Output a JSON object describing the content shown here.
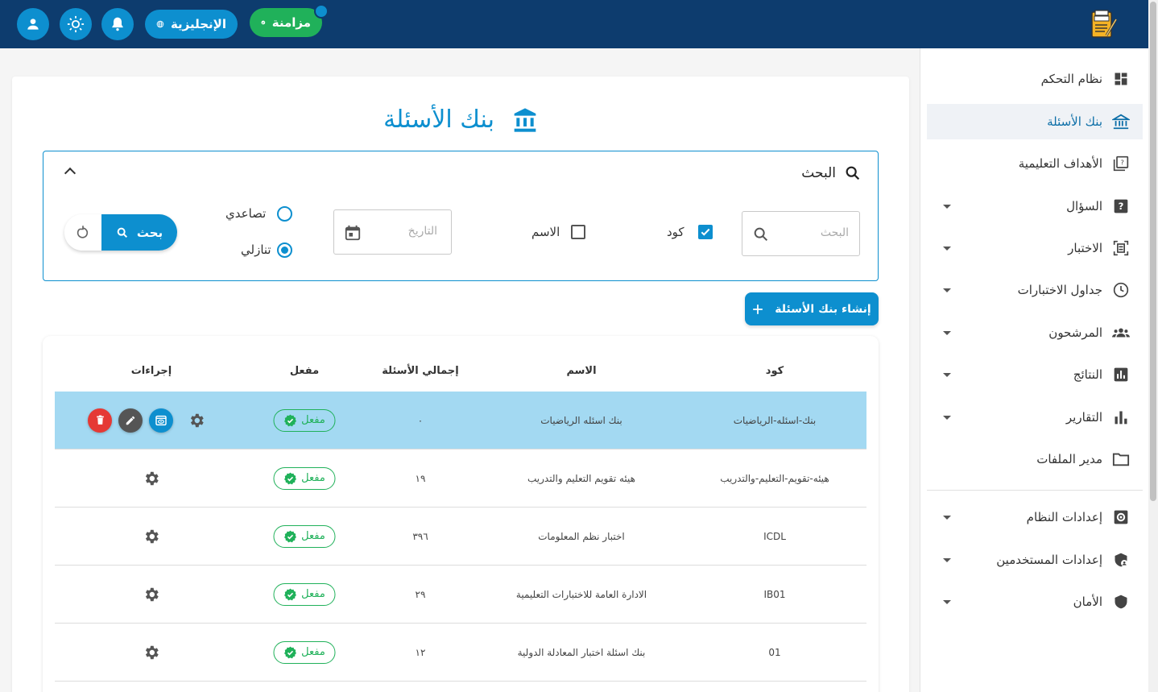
{
  "topbar": {
    "sync_label": "مزامنة",
    "language_label": "الإنجليزية"
  },
  "sidebar": {
    "items": [
      {
        "label": "نظام التحكم",
        "icon": "dashboard-icon"
      },
      {
        "label": "بنك الأسئلة",
        "icon": "bank-icon"
      },
      {
        "label": "الأهداف التعليمية",
        "icon": "objectives-icon"
      },
      {
        "label": "السؤال",
        "icon": "question-icon"
      },
      {
        "label": "الاختبار",
        "icon": "exam-icon"
      },
      {
        "label": "جداول الاختبارات",
        "icon": "clock-icon"
      },
      {
        "label": "المرشحون",
        "icon": "people-icon"
      },
      {
        "label": "النتائج",
        "icon": "results-icon"
      },
      {
        "label": "التقارير",
        "icon": "bar-chart-icon"
      },
      {
        "label": "مدير الملفات",
        "icon": "folder-icon"
      },
      {
        "label": "إعدادات النظام",
        "icon": "settings-box-icon"
      },
      {
        "label": "إعدادات المستخدمين",
        "icon": "shield-user-icon"
      },
      {
        "label": "الأمان",
        "icon": "shield-icon"
      }
    ]
  },
  "page": {
    "title": "بنك الأسئلة"
  },
  "search": {
    "heading": "البحث",
    "search_placeholder": "البحث",
    "code_label": "كود",
    "code_checked": true,
    "name_label": "الاسم",
    "name_checked": false,
    "date_placeholder": "التاريخ",
    "ascending_label": "تصاعدي",
    "descending_label": "تنازلي",
    "sort": "descending",
    "search_button": "بحث"
  },
  "create_button": "إنشاء بنك الأسئلة",
  "table": {
    "headers": {
      "code": "كود",
      "name": "الاسم",
      "total": "إجمالي الأسئلة",
      "enabled": "مفعل",
      "actions": "إجراءات"
    },
    "status_label": "مفعل",
    "rows": [
      {
        "code": "بنك-اسئله-الرياضيات",
        "name": "بنك اسئله الرياضيات",
        "total": "٠",
        "selected": true
      },
      {
        "code": "هيئه-تقويم-التعليم-والتدريب",
        "name": "هيئه تقويم التعليم والتدريب",
        "total": "١٩",
        "selected": false
      },
      {
        "code": "ICDL",
        "name": "اختبار نظم المعلومات",
        "total": "٣٩٦",
        "selected": false
      },
      {
        "code": "IB01",
        "name": "الادارة العامة للاختبارات التعليمية",
        "total": "٢٩",
        "selected": false
      },
      {
        "code": "01",
        "name": "بنك اسئلة اختبار المعادلة الدولية",
        "total": "١٢",
        "selected": false
      }
    ]
  },
  "colors": {
    "primary": "#0d8fcf",
    "topbar": "#0d3c6e",
    "success": "#20b15a",
    "danger": "#e53935",
    "selected_row": "#a3d9f2"
  }
}
